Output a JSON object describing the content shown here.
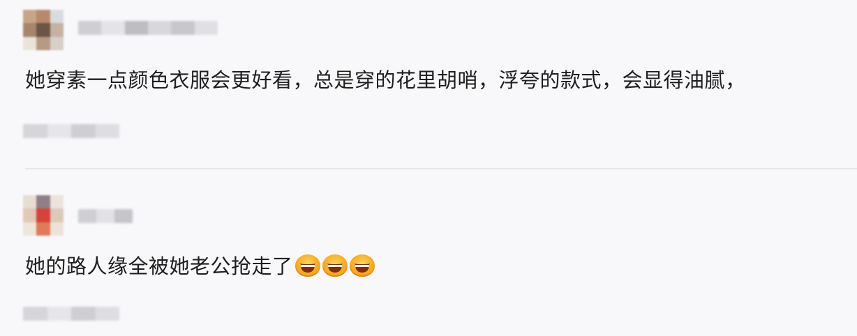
{
  "comments": [
    {
      "text": "她穿素一点颜色衣服会更好看，总是穿的花里胡哨，浮夸的款式，会显得油腻，",
      "emoji_count": 0,
      "avatar_colors": [
        "#c9a488",
        "#b98a6a",
        "#d9dcdf",
        "#a7856c",
        "#6b5546",
        "#c4b2a3",
        "#ebe3da",
        "#b79a85",
        "#d8cfc6"
      ],
      "username_colors": [
        "#cfcfd3",
        "#e4e4e8",
        "#bdbdc2",
        "#d8d8dc",
        "#c8c8cc",
        "#e0e0e4"
      ],
      "meta_colors": [
        "#d6d6da",
        "#e6e6ea",
        "#cfcfd3",
        "#dedee2"
      ]
    },
    {
      "text": "她的路人缘全被她老公抢走了",
      "emoji_count": 3,
      "emoji_icon": "laughing-face-icon",
      "avatar_colors": [
        "#e8ddd3",
        "#8f7f86",
        "#ece4dc",
        "#dfc9b7",
        "#d4443a",
        "#dcc9b9",
        "#efe5da",
        "#e07a58",
        "#ede2d7"
      ],
      "username_colors": [
        "#cfcfd3",
        "#e2e2e6",
        "#c6c6ca"
      ],
      "meta_colors": [
        "#d6d6da",
        "#e6e6ea",
        "#cfcfd3",
        "#dedee2"
      ]
    }
  ]
}
